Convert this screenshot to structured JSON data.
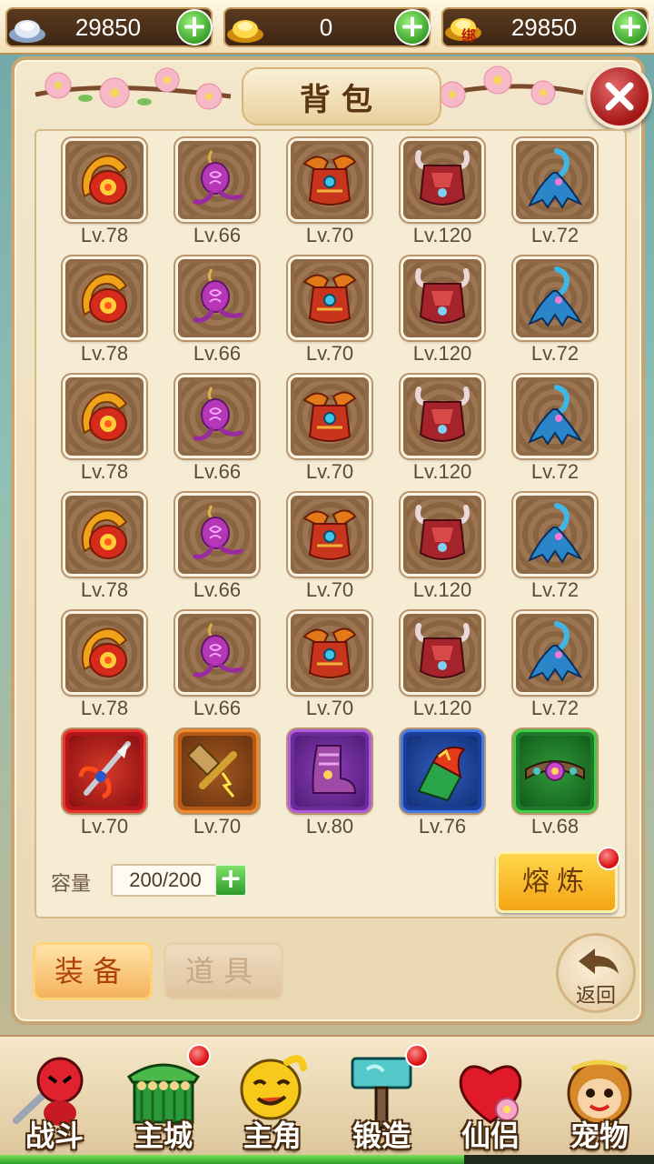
{
  "currency": {
    "silver": {
      "value": "29850",
      "icon": "silver-ingot-icon"
    },
    "gold": {
      "value": "0",
      "icon": "gold-ingot-icon"
    },
    "bound_gold": {
      "value": "29850",
      "icon": "bound-gold-ingot-icon",
      "badge": "绑"
    }
  },
  "panel": {
    "title": "背包",
    "close_icon": "close-icon"
  },
  "inventory": {
    "items": [
      {
        "level": "Lv.78",
        "icon": "red-amulet-icon",
        "quality": "normal"
      },
      {
        "level": "Lv.66",
        "icon": "purple-pendant-icon",
        "quality": "normal"
      },
      {
        "level": "Lv.70",
        "icon": "red-armor-icon",
        "quality": "normal"
      },
      {
        "level": "Lv.120",
        "icon": "horned-armor-icon",
        "quality": "normal"
      },
      {
        "level": "Lv.72",
        "icon": "blue-cape-icon",
        "quality": "normal"
      },
      {
        "level": "Lv.78",
        "icon": "red-amulet-icon",
        "quality": "normal"
      },
      {
        "level": "Lv.66",
        "icon": "purple-pendant-icon",
        "quality": "normal"
      },
      {
        "level": "Lv.70",
        "icon": "red-armor-icon",
        "quality": "normal"
      },
      {
        "level": "Lv.120",
        "icon": "horned-armor-icon",
        "quality": "normal"
      },
      {
        "level": "Lv.72",
        "icon": "blue-cape-icon",
        "quality": "normal"
      },
      {
        "level": "Lv.78",
        "icon": "red-amulet-icon",
        "quality": "normal"
      },
      {
        "level": "Lv.66",
        "icon": "purple-pendant-icon",
        "quality": "normal"
      },
      {
        "level": "Lv.70",
        "icon": "red-armor-icon",
        "quality": "normal"
      },
      {
        "level": "Lv.120",
        "icon": "horned-armor-icon",
        "quality": "normal"
      },
      {
        "level": "Lv.72",
        "icon": "blue-cape-icon",
        "quality": "normal"
      },
      {
        "level": "Lv.78",
        "icon": "red-amulet-icon",
        "quality": "normal"
      },
      {
        "level": "Lv.66",
        "icon": "purple-pendant-icon",
        "quality": "normal"
      },
      {
        "level": "Lv.70",
        "icon": "red-armor-icon",
        "quality": "normal"
      },
      {
        "level": "Lv.120",
        "icon": "horned-armor-icon",
        "quality": "normal"
      },
      {
        "level": "Lv.72",
        "icon": "blue-cape-icon",
        "quality": "normal"
      },
      {
        "level": "Lv.78",
        "icon": "red-amulet-icon",
        "quality": "normal"
      },
      {
        "level": "Lv.66",
        "icon": "purple-pendant-icon",
        "quality": "normal"
      },
      {
        "level": "Lv.70",
        "icon": "red-armor-icon",
        "quality": "normal"
      },
      {
        "level": "Lv.120",
        "icon": "horned-armor-icon",
        "quality": "normal"
      },
      {
        "level": "Lv.72",
        "icon": "blue-cape-icon",
        "quality": "normal"
      },
      {
        "level": "Lv.70",
        "icon": "spear-icon",
        "quality": "red"
      },
      {
        "level": "Lv.70",
        "icon": "hammer-icon",
        "quality": "orange"
      },
      {
        "level": "Lv.80",
        "icon": "purple-boots-icon",
        "quality": "purple"
      },
      {
        "level": "Lv.76",
        "icon": "dragon-bracer-icon",
        "quality": "blue"
      },
      {
        "level": "Lv.68",
        "icon": "jade-belt-icon",
        "quality": "green"
      }
    ]
  },
  "capacity": {
    "label": "容量",
    "value": "200/200",
    "plus_icon": "plus-icon"
  },
  "smelt_button": "熔炼",
  "tabs": {
    "equipment": "装备",
    "items": "道具"
  },
  "back_button": "返回",
  "nav": [
    {
      "label": "战斗",
      "icon": "battle-icon",
      "badge": false
    },
    {
      "label": "主城",
      "icon": "main-city-icon",
      "badge": true
    },
    {
      "label": "主角",
      "icon": "hero-icon",
      "badge": false
    },
    {
      "label": "锻造",
      "icon": "forge-hammer-icon",
      "badge": true
    },
    {
      "label": "仙侣",
      "icon": "companion-heart-icon",
      "badge": false
    },
    {
      "label": "宠物",
      "icon": "pet-monkey-icon",
      "badge": false
    }
  ],
  "progress": 0.71,
  "colors": {
    "panel_bg": "#f3e7cc",
    "accent_gold": "#f3a514",
    "plus_green": "#3aa32a",
    "badge_red": "#d90f0f"
  }
}
